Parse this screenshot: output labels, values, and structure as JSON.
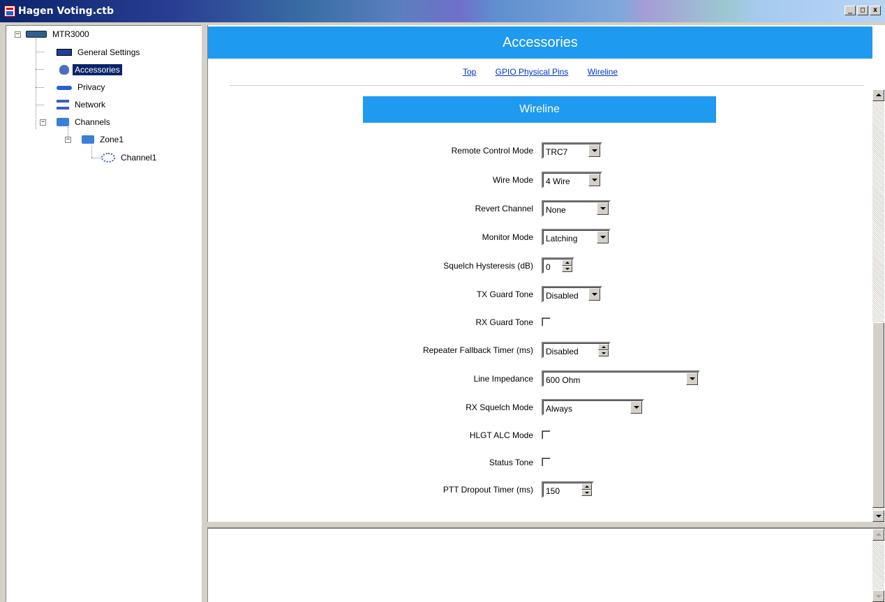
{
  "window": {
    "title": "Hagen Voting.ctb",
    "minimize_label": "_",
    "maximize_label": "□",
    "close_label": "x"
  },
  "tree": {
    "root": "MTR3000",
    "items": [
      {
        "label": "General Settings",
        "icon": "set-icon"
      },
      {
        "label": "Accessories",
        "icon": "accessories-icon",
        "selected": true
      },
      {
        "label": "Privacy",
        "icon": "key-icon"
      },
      {
        "label": "Network",
        "icon": "network-icon"
      },
      {
        "label": "Channels",
        "icon": "folder-icon"
      },
      {
        "label": "Zone1",
        "icon": "folder-icon"
      },
      {
        "label": "Channel1",
        "icon": "channel-icon"
      }
    ]
  },
  "main": {
    "header": "Accessories",
    "links": [
      "Top",
      "GPIO Physical Pins",
      "Wireline"
    ],
    "section_title": "Wireline",
    "fields": {
      "remote_control_mode": {
        "label": "Remote Control Mode",
        "value": "TRC7"
      },
      "wire_mode": {
        "label": "Wire Mode",
        "value": "4 Wire"
      },
      "revert_channel": {
        "label": "Revert Channel",
        "value": "None"
      },
      "monitor_mode": {
        "label": "Monitor Mode",
        "value": "Latching"
      },
      "squelch_hysteresis": {
        "label": "Squelch Hysteresis (dB)",
        "value": "0"
      },
      "tx_guard_tone": {
        "label": "TX Guard Tone",
        "value": "Disabled"
      },
      "rx_guard_tone": {
        "label": "RX Guard Tone",
        "checked": false
      },
      "repeater_fallback_timer": {
        "label": "Repeater Fallback Timer (ms)",
        "value": "Disabled"
      },
      "line_impedance": {
        "label": "Line Impedance",
        "value": "600 Ohm"
      },
      "rx_squelch_mode": {
        "label": "RX Squelch Mode",
        "value": "Always"
      },
      "hlgt_alc_mode": {
        "label": "HLGT ALC Mode",
        "checked": false
      },
      "status_tone": {
        "label": "Status Tone",
        "checked": false
      },
      "ptt_dropout_timer": {
        "label": "PTT Dropout Timer (ms)",
        "value": "150"
      }
    }
  },
  "colors": {
    "accent": "#1e9af0",
    "selection": "#0a246a",
    "link": "#0033cc"
  }
}
